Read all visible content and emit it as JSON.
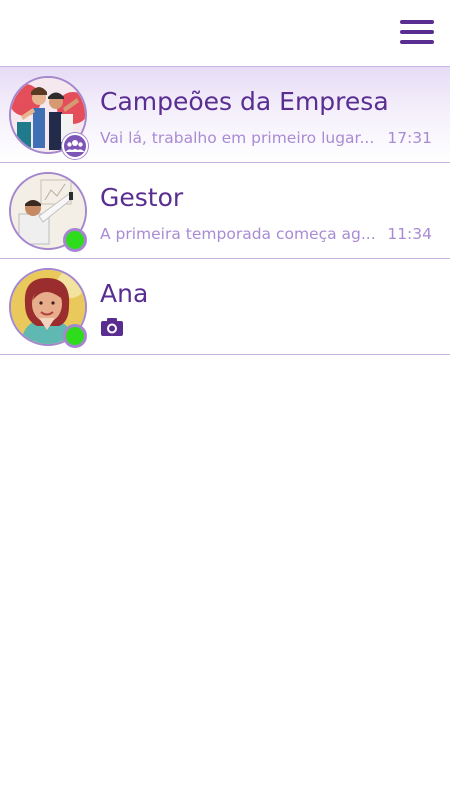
{
  "header": {
    "menu_icon": "hamburger-menu-icon"
  },
  "colors": {
    "accent": "#5a2d91",
    "secondary_text": "#a98bd4",
    "divider": "#c8b3e2",
    "online": "#2fdc1c"
  },
  "chats": [
    {
      "name": "Campeões da Empresa",
      "preview": "Vai lá, trabalho em primeiro lugar...",
      "time": "17:31",
      "is_group": true,
      "badge_icon": "group-icon"
    },
    {
      "name": "Gestor",
      "preview": "A primeira temporada começa ag...",
      "time": "11:34",
      "online": true
    },
    {
      "name": "Ana",
      "preview_icon": "camera-icon",
      "online": true
    }
  ]
}
